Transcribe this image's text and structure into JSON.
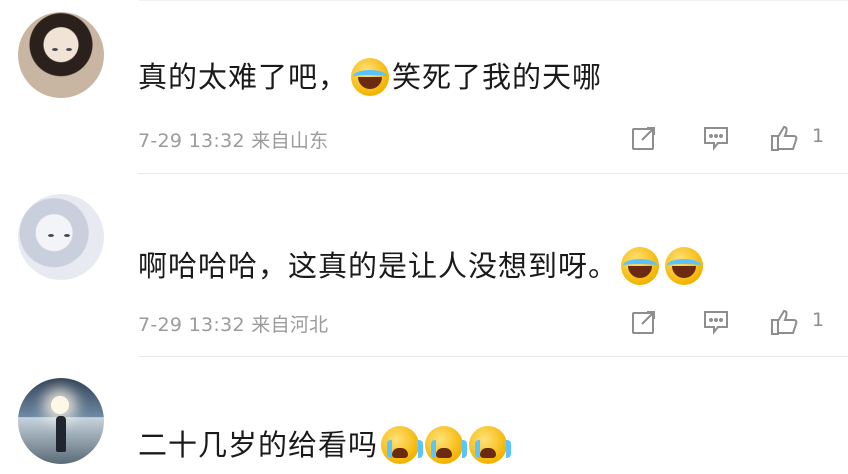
{
  "comments": [
    {
      "text_before": "真的太难了吧，",
      "emoji_mid": "laughing-crying-emoji",
      "text_after": "笑死了我的天哪",
      "time": "7-29 13:32",
      "location": "来自山东",
      "likes": "1"
    },
    {
      "text": "啊哈哈哈，这真的是让人没想到呀。",
      "emojis": [
        "laughing-crying-emoji",
        "laughing-crying-emoji"
      ],
      "time": "7-29 13:32",
      "location": "来自河北",
      "likes": "1"
    },
    {
      "text": "二十几岁的给看吗",
      "emojis": [
        "crying-emoji",
        "crying-emoji",
        "crying-emoji"
      ]
    }
  ],
  "icons": {
    "share": "share-icon",
    "reply": "comment-icon",
    "like": "thumbs-up-icon"
  },
  "colors": {
    "text": "#1a1a1a",
    "meta": "#9b9b9b",
    "divider": "#e9e9e9"
  }
}
